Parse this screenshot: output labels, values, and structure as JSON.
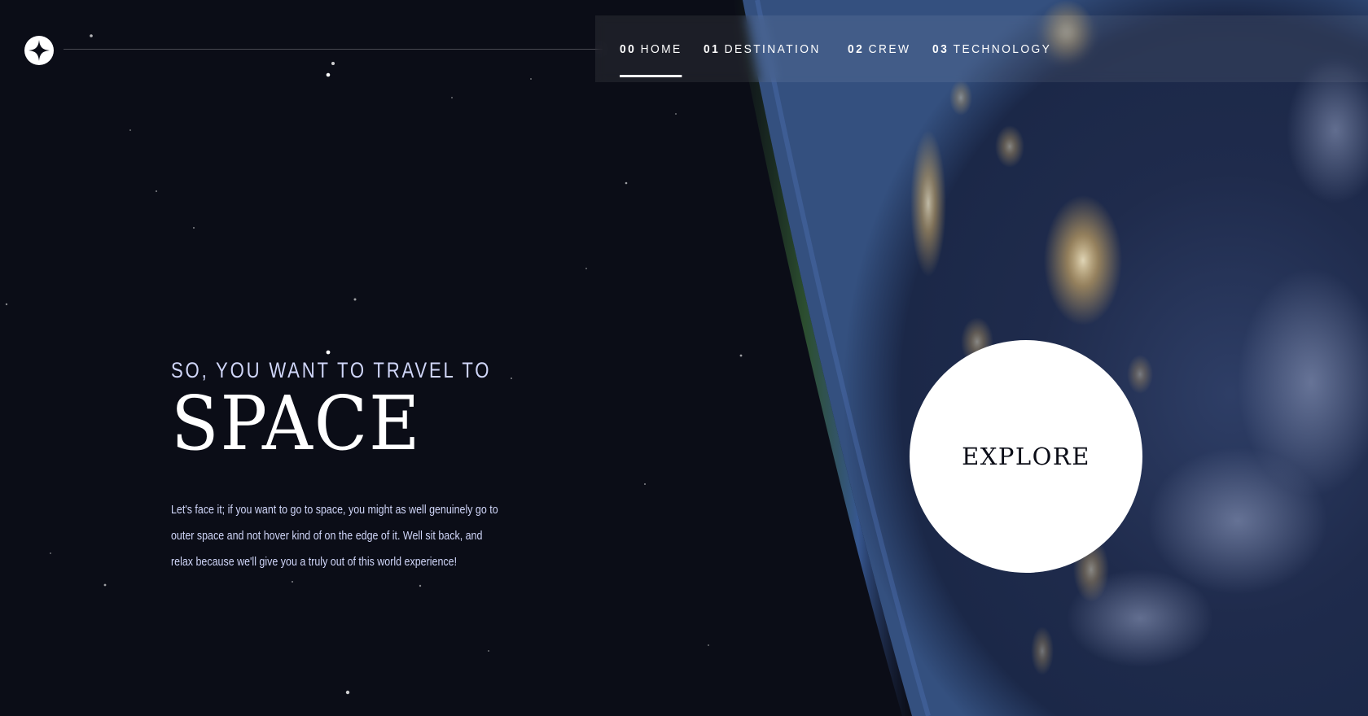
{
  "nav": {
    "items": [
      {
        "number": "00",
        "label": "HOME",
        "active": true
      },
      {
        "number": "01",
        "label": "DESTINATION",
        "active": false
      },
      {
        "number": "02",
        "label": "CREW",
        "active": false
      },
      {
        "number": "03",
        "label": "TECHNOLOGY",
        "active": false
      }
    ]
  },
  "hero": {
    "subtitle": "SO, YOU WANT TO TRAVEL TO",
    "title": "SPACE",
    "description": "Let's face it; if you want to go to space, you might as well genuinely go to outer space and not hover kind of on the edge of it. Well sit back, and relax because we'll give you a truly out of this world experience!"
  },
  "explore_button": {
    "label": "EXPLORE"
  },
  "colors": {
    "background": "#0b0d17",
    "text_light": "#d0d6f9",
    "white": "#ffffff"
  },
  "icons": {
    "logo": "four-point-star-logo-icon"
  }
}
